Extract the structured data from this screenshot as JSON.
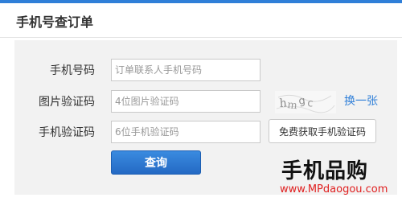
{
  "page": {
    "title": "手机号查订单"
  },
  "form": {
    "phone": {
      "label": "手机号码",
      "placeholder": "订单联系人手机号码"
    },
    "image_code": {
      "label": "图片验证码",
      "placeholder": "4位图片验证码",
      "refresh_label": "换一张"
    },
    "sms_code": {
      "label": "手机验证码",
      "placeholder": "6位手机验证码",
      "send_button_label": "免费获取手机验证码"
    },
    "submit_label": "查询"
  },
  "colors": {
    "accent": "#2f7fd8",
    "button_blue": "#2469c4",
    "panel_bg": "#f2f2f2",
    "watermark_red": "#e02020"
  },
  "watermark": {
    "brand": "手机品购",
    "url": "www.MPdaogou.com"
  }
}
